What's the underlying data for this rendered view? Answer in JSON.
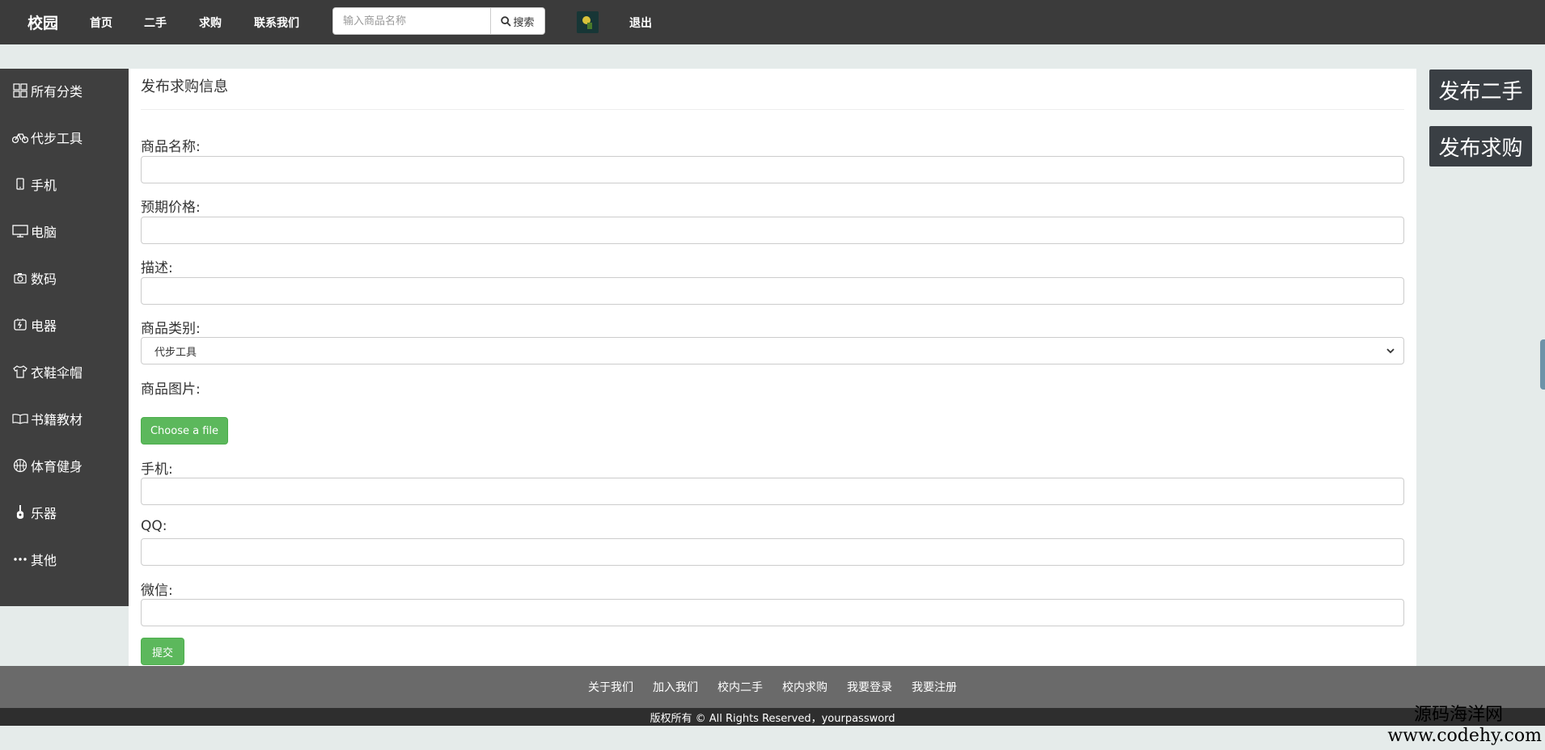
{
  "nav": {
    "brand": "校园",
    "links": [
      "首页",
      "二手",
      "求购",
      "联系我们"
    ],
    "search_placeholder": "输入商品名称",
    "search_button": "搜索",
    "logout": "退出"
  },
  "sidebar": {
    "items": [
      {
        "label": "所有分类",
        "icon": "grid-icon"
      },
      {
        "label": "代步工具",
        "icon": "bicycle-icon"
      },
      {
        "label": "手机",
        "icon": "phone-icon"
      },
      {
        "label": "电脑",
        "icon": "monitor-icon"
      },
      {
        "label": "数码",
        "icon": "camera-icon"
      },
      {
        "label": "电器",
        "icon": "plug-icon"
      },
      {
        "label": "衣鞋伞帽",
        "icon": "shirt-icon"
      },
      {
        "label": "书籍教材",
        "icon": "book-icon"
      },
      {
        "label": "体育健身",
        "icon": "basketball-icon"
      },
      {
        "label": "乐器",
        "icon": "guitar-icon"
      },
      {
        "label": "其他",
        "icon": "more-icon"
      }
    ]
  },
  "form": {
    "title": "发布求购信息",
    "name_label": "商品名称:",
    "price_label": "预期价格:",
    "desc_label": "描述:",
    "category_label": "商品类别:",
    "category_value": "代步工具",
    "image_label": "商品图片:",
    "file_button": "Choose a file",
    "phone_label": "手机:",
    "qq_label": "QQ:",
    "wechat_label": "微信:",
    "submit": "提交"
  },
  "actions": {
    "publish_used": "发布二手",
    "publish_wanted": "发布求购"
  },
  "footer": {
    "links": [
      "关于我们",
      "加入我们",
      "校内二手",
      "校内求购",
      "我要登录",
      "我要注册"
    ],
    "copyright": "版权所有 © All Rights Reserved，yourpassword"
  },
  "watermark": {
    "line1": "源码海洋网",
    "line2": "www.codehy.com"
  },
  "colors": {
    "topbar": "#3b3b3b",
    "sidebar": "#3f3f3f",
    "success": "#5cb85c",
    "action": "#3a3f44"
  }
}
